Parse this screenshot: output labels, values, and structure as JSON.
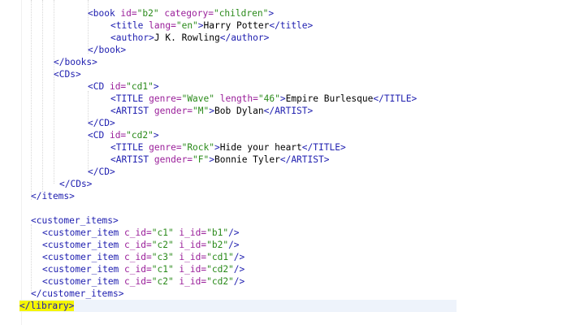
{
  "editor": {
    "language": "xml",
    "current_line_index": 24,
    "colors": {
      "tag": "#2020b0",
      "attribute": "#9a1f9a",
      "value": "#2a8a1a",
      "text": "#000000",
      "bracket_highlight": "#f5f500",
      "current_line": "#eef3fb"
    },
    "lines": [
      {
        "indent": 108,
        "tokens": [
          [
            "tag",
            "<book "
          ],
          [
            "attr",
            "id="
          ],
          [
            "val",
            "\"b2\""
          ],
          [
            "attr",
            " category="
          ],
          [
            "val",
            "\"children\""
          ],
          [
            "tag",
            ">"
          ]
        ]
      },
      {
        "indent": 136,
        "tokens": [
          [
            "tag",
            "<title "
          ],
          [
            "attr",
            "lang="
          ],
          [
            "val",
            "\"en\""
          ],
          [
            "tag",
            ">"
          ],
          [
            "txt",
            "Harry Potter"
          ],
          [
            "tag",
            "</title>"
          ]
        ]
      },
      {
        "indent": 136,
        "tokens": [
          [
            "tag",
            "<author>"
          ],
          [
            "txt",
            "J K. Rowling"
          ],
          [
            "tag",
            "</author>"
          ]
        ]
      },
      {
        "indent": 108,
        "tokens": [
          [
            "tag",
            "</book>"
          ]
        ]
      },
      {
        "indent": 66,
        "tokens": [
          [
            "tag",
            "</books>"
          ]
        ]
      },
      {
        "indent": 66,
        "tokens": [
          [
            "tag",
            "<CDs>"
          ]
        ]
      },
      {
        "indent": 108,
        "tokens": [
          [
            "tag",
            "<CD "
          ],
          [
            "attr",
            "id="
          ],
          [
            "val",
            "\"cd1\""
          ],
          [
            "tag",
            ">"
          ]
        ]
      },
      {
        "indent": 136,
        "tokens": [
          [
            "tag",
            "<TITLE "
          ],
          [
            "attr",
            "genre="
          ],
          [
            "val",
            "\"Wave\""
          ],
          [
            "attr",
            " length="
          ],
          [
            "val",
            "\"46\""
          ],
          [
            "tag",
            ">"
          ],
          [
            "txt",
            "Empire Burlesque"
          ],
          [
            "tag",
            "</TITLE>"
          ]
        ]
      },
      {
        "indent": 136,
        "tokens": [
          [
            "tag",
            "<ARTIST "
          ],
          [
            "attr",
            "gender="
          ],
          [
            "val",
            "\"M\""
          ],
          [
            "tag",
            ">"
          ],
          [
            "txt",
            "Bob Dylan"
          ],
          [
            "tag",
            "</ARTIST>"
          ]
        ]
      },
      {
        "indent": 108,
        "tokens": [
          [
            "tag",
            "</CD>"
          ]
        ]
      },
      {
        "indent": 108,
        "tokens": [
          [
            "tag",
            "<CD "
          ],
          [
            "attr",
            "id="
          ],
          [
            "val",
            "\"cd2\""
          ],
          [
            "tag",
            ">"
          ]
        ]
      },
      {
        "indent": 136,
        "tokens": [
          [
            "tag",
            "<TITLE "
          ],
          [
            "attr",
            "genre="
          ],
          [
            "val",
            "\"Rock\""
          ],
          [
            "tag",
            ">"
          ],
          [
            "txt",
            "Hide your heart"
          ],
          [
            "tag",
            "</TITLE>"
          ]
        ]
      },
      {
        "indent": 136,
        "tokens": [
          [
            "tag",
            "<ARTIST "
          ],
          [
            "attr",
            "gender="
          ],
          [
            "val",
            "\"F\""
          ],
          [
            "tag",
            ">"
          ],
          [
            "txt",
            "Bonnie Tyler"
          ],
          [
            "tag",
            "</ARTIST>"
          ]
        ]
      },
      {
        "indent": 108,
        "tokens": [
          [
            "tag",
            "</CD>"
          ]
        ]
      },
      {
        "indent": 73,
        "tokens": [
          [
            "tag",
            "</CDs>"
          ]
        ]
      },
      {
        "indent": 38,
        "tokens": [
          [
            "tag",
            "</items>"
          ]
        ]
      },
      {
        "indent": 38,
        "tokens": []
      },
      {
        "indent": 38,
        "tokens": [
          [
            "tag",
            "<customer_items>"
          ]
        ]
      },
      {
        "indent": 52,
        "tokens": [
          [
            "tag",
            "<customer_item "
          ],
          [
            "attr",
            "c_id="
          ],
          [
            "val",
            "\"c1\""
          ],
          [
            "attr",
            " i_id="
          ],
          [
            "val",
            "\"b1\""
          ],
          [
            "tag",
            "/>"
          ]
        ]
      },
      {
        "indent": 52,
        "tokens": [
          [
            "tag",
            "<customer_item "
          ],
          [
            "attr",
            "c_id="
          ],
          [
            "val",
            "\"c2\""
          ],
          [
            "attr",
            " i_id="
          ],
          [
            "val",
            "\"b2\""
          ],
          [
            "tag",
            "/>"
          ]
        ]
      },
      {
        "indent": 52,
        "tokens": [
          [
            "tag",
            "<customer_item "
          ],
          [
            "attr",
            "c_id="
          ],
          [
            "val",
            "\"c3\""
          ],
          [
            "attr",
            " i_id="
          ],
          [
            "val",
            "\"cd1\""
          ],
          [
            "tag",
            "/>"
          ]
        ]
      },
      {
        "indent": 52,
        "tokens": [
          [
            "tag",
            "<customer_item "
          ],
          [
            "attr",
            "c_id="
          ],
          [
            "val",
            "\"c1\""
          ],
          [
            "attr",
            " i_id="
          ],
          [
            "val",
            "\"cd2\""
          ],
          [
            "tag",
            "/>"
          ]
        ]
      },
      {
        "indent": 52,
        "tokens": [
          [
            "tag",
            "<customer_item "
          ],
          [
            "attr",
            "c_id="
          ],
          [
            "val",
            "\"c2\""
          ],
          [
            "attr",
            " i_id="
          ],
          [
            "val",
            "\"cd2\""
          ],
          [
            "tag",
            "/>"
          ]
        ]
      },
      {
        "indent": 38,
        "tokens": [
          [
            "tag",
            "</customer_items>"
          ]
        ]
      },
      {
        "indent": 24,
        "tokens": [
          [
            "hl",
            "</library>"
          ]
        ]
      }
    ]
  }
}
